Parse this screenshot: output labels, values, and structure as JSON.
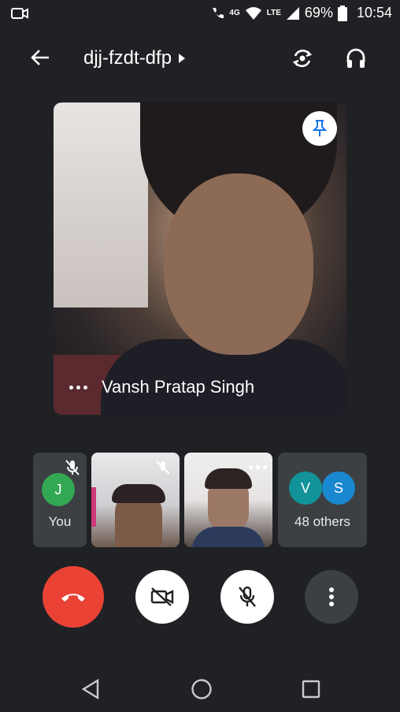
{
  "status_bar": {
    "network_tag": "4G",
    "lte_tag": "LTE",
    "battery": "69%",
    "time": "10:54"
  },
  "header": {
    "meeting_code": "djj-fzdt-dfp"
  },
  "main_video": {
    "speaker_name": "Vansh Pratap Singh"
  },
  "tiles": {
    "self": {
      "avatar_letter": "J",
      "label": "You",
      "avatar_color": "#33a852"
    },
    "others": {
      "avatars": [
        {
          "letter": "V",
          "color": "#12939a"
        },
        {
          "letter": "S",
          "color": "#1a88d0"
        }
      ],
      "label": "48 others"
    }
  },
  "colors": {
    "end_call": "#ea4335",
    "background": "#202124",
    "tile": "#3c4043"
  },
  "icons": [
    "camera-icon",
    "wifi-icon",
    "signal-icon",
    "battery-icon",
    "back-arrow-icon",
    "chevron-right-icon",
    "switch-camera-icon",
    "headphones-icon",
    "pin-icon",
    "more-dots-icon",
    "mic-off-icon",
    "end-call-icon",
    "camera-off-icon",
    "more-vert-icon",
    "nav-back-icon",
    "nav-home-icon",
    "nav-recents-icon"
  ]
}
